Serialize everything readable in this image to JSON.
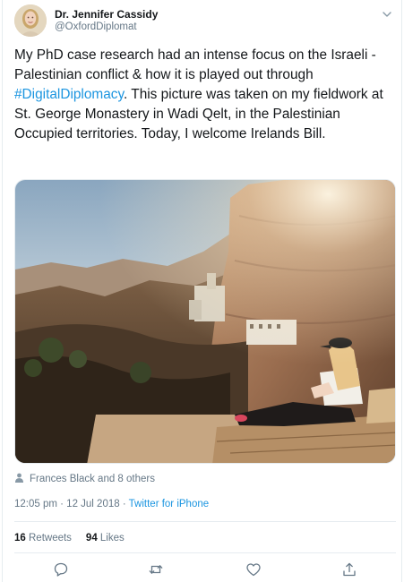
{
  "tweet": {
    "author_name": "Dr. Jennifer Cassidy",
    "author_handle": "@OxfordDiplomat",
    "text_before": "My PhD case research had an intense focus on the Israeli - Palestinian conflict & how it is played out through ",
    "hashtag": "#DigitalDiplomacy",
    "text_after": ". This picture was taken on my fieldwork at St. George Monastery in Wadi Qelt, in the Palestinian Occupied territories. Today, I welcome Irelands Bill.",
    "liked_by": "Frances Black and 8 others",
    "time_date": "12:05 pm · 12 Jul 2018 · ",
    "source": "Twitter for iPhone",
    "retweets_count": "16",
    "retweets_label": " Retweets",
    "likes_count": "94",
    "likes_label": " Likes"
  },
  "icons": {
    "menu": "chevron-down-icon",
    "liked_by": "person-icon",
    "reply": "reply-icon",
    "retweet": "retweet-icon",
    "like": "heart-icon",
    "share": "share-icon"
  },
  "colors": {
    "link": "#1b95e0",
    "secondary_text": "#657786",
    "primary_text": "#14171a",
    "border": "#e6ecf0"
  }
}
